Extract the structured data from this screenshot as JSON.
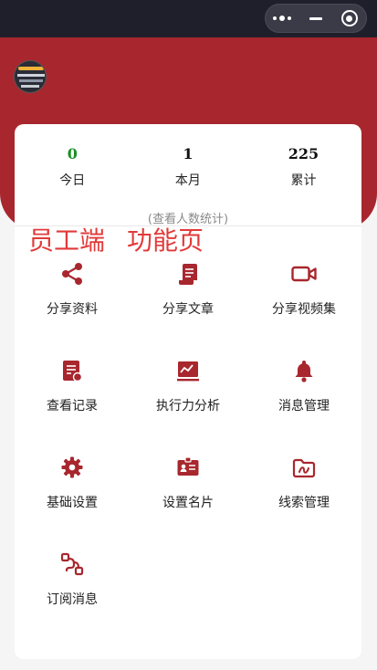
{
  "stats": [
    {
      "value": "0",
      "label": "今日"
    },
    {
      "value": "1",
      "label": "本月"
    },
    {
      "value": "225",
      "label": "累计"
    }
  ],
  "stats_link": "(查看人数统计)",
  "overlay": {
    "left": "员工端",
    "right": "功能页"
  },
  "menu": [
    {
      "label": "分享资料",
      "icon": "share-icon"
    },
    {
      "label": "分享文章",
      "icon": "scroll-icon"
    },
    {
      "label": "分享视频集",
      "icon": "video-camera-icon"
    },
    {
      "label": "查看记录",
      "icon": "record-icon"
    },
    {
      "label": "执行力分析",
      "icon": "analysis-icon"
    },
    {
      "label": "消息管理",
      "icon": "bell-icon"
    },
    {
      "label": "基础设置",
      "icon": "gear-icon"
    },
    {
      "label": "设置名片",
      "icon": "id-card-icon"
    },
    {
      "label": "线索管理",
      "icon": "folder-clue-icon"
    },
    {
      "label": "订阅消息",
      "icon": "subscribe-icon"
    }
  ],
  "colors": {
    "brand": "#a8272e",
    "accent": "#e23a3a",
    "green": "#1a8f24"
  }
}
